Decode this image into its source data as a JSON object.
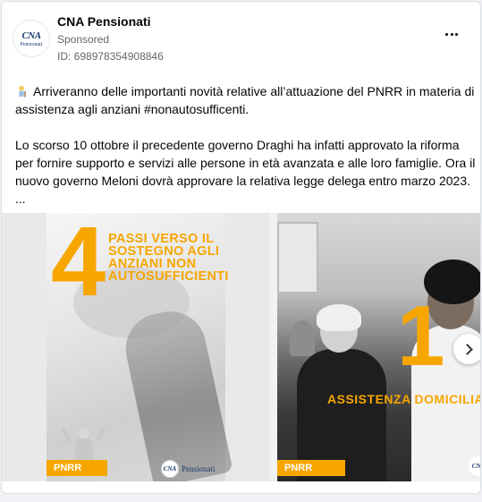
{
  "post": {
    "page_name": "CNA Pensionati",
    "sponsored_label": "Sponsored",
    "ad_id": "ID: 698978354908846",
    "avatar": {
      "mark": "CNA",
      "word": "Pensionati"
    },
    "more_icon": "ellipsis-icon",
    "body": {
      "paragraph_1": "Arriveranno delle importanti novità relative all’attuazione del PNRR in materia di assistenza agli anziani #nonautosufficenti.",
      "paragraph_2": "Lo scorso 10 ottobre il precedente governo Draghi ha infatti approvato la riforma per fornire supporto e servizi alle persone in età avanzata e alle loro famiglie. Ora il nuovo governo Meloni dovrà approvare la relativa legge delega entro marzo 2023.",
      "ellipsis": "...",
      "emoji_icon": "older-person-icon"
    }
  },
  "carousel": {
    "slides": [
      {
        "big_number": "4",
        "headline": "Passi verso il sostegno agli anziani non autosufficienti",
        "tag": "PNRR",
        "logo_mark": "CNA",
        "logo_word": "Pensionati"
      },
      {
        "big_number": "1",
        "headline": "Assistenza domicilia",
        "tag": "PNRR",
        "logo_mark": "CNA"
      }
    ],
    "next_icon": "chevron-right-icon"
  },
  "colors": {
    "accent": "#f7a600",
    "text": "#050505",
    "muted": "#65676b",
    "brand_blue": "#1a3a6e"
  }
}
